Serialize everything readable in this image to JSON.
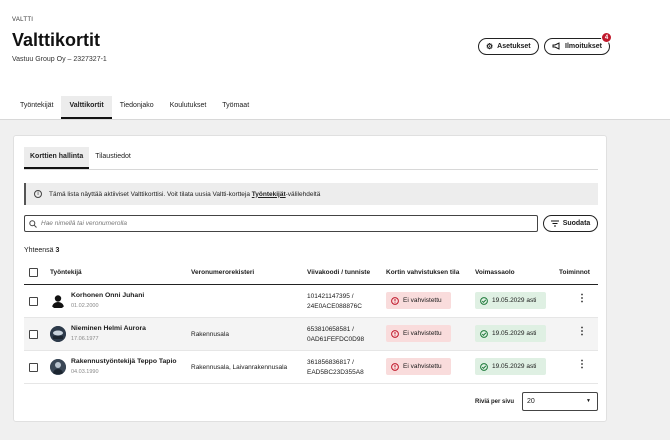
{
  "header": {
    "eyebrow": "VALTTI",
    "title": "Valttikortit",
    "subtitle": "Vastuu Group Oy – 2327327-1",
    "settings_label": "Asetukset",
    "notifications_label": "Ilmoitukset",
    "notifications_count": "4"
  },
  "nav": {
    "tabs": [
      "Työntekijät",
      "Valttikortit",
      "Tiedonjako",
      "Koulutukset",
      "Työmaat"
    ],
    "active": "Valttikortit"
  },
  "subtabs": [
    "Korttien hallinta",
    "Tilaustiedot"
  ],
  "info": {
    "text_before": "Tämä lista näyttää aktiiviset Valttikorttisi. Voit tilata uusia Valtti-kortteja ",
    "link": "Työntekijät",
    "text_after": "-välilehdeltä"
  },
  "search": {
    "placeholder": "Hae nimellä tai veronumerolla"
  },
  "filter_label": "Suodata",
  "total": {
    "label": "Yhteensä",
    "count": "3"
  },
  "table": {
    "columns": [
      "Työntekijä",
      "Veronumerorekisteri",
      "Viivakoodi / tunniste",
      "Kortin vahvistuksen tila",
      "Voimassaolo",
      "Toiminnot"
    ],
    "rows": [
      {
        "name": "Korhonen Onni Juhani",
        "dob": "01.02.2000",
        "register": "",
        "code1": "101421147395 /",
        "code2": "24E0ACE088876C",
        "status": "Ei vahvistettu",
        "validity": "19.05.2029 asti"
      },
      {
        "name": "Nieminen Helmi Aurora",
        "dob": "17.06.1977",
        "register": "Rakennusala",
        "code1": "653810658581 /",
        "code2": "0AD61FEFDC0D98",
        "status": "Ei vahvistettu",
        "validity": "19.05.2029 asti"
      },
      {
        "name": "Rakennustyöntekijä Teppo Tapio",
        "dob": "04.03.1990",
        "register": "Rakennusala, Laivanrakennusala",
        "code1": "361856836817 /",
        "code2": "EAD5BC23D355A8",
        "status": "Ei vahvistettu",
        "validity": "19.05.2029 asti"
      }
    ]
  },
  "pagination": {
    "label": "Riviä per sivu",
    "value": "20"
  },
  "colors": {
    "error_bg": "#f9dcdc",
    "error": "#c0182b",
    "success_bg": "#dff0e3",
    "success": "#1e7a3a",
    "badge": "#c0182b"
  },
  "icons": {
    "settings": "gear-icon",
    "notifications": "megaphone-icon",
    "info": "info-icon",
    "search": "search-icon",
    "filter": "filter-icon",
    "status": "alert-circle-icon",
    "validity": "check-circle-icon",
    "actions": "kebab-icon"
  }
}
